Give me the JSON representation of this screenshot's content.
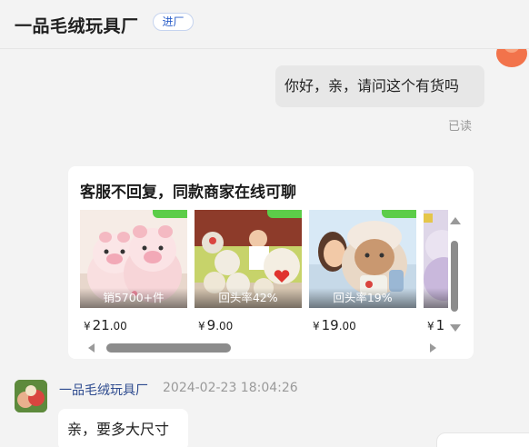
{
  "header": {
    "shop_name": "一品毛绒玩具厂",
    "enter_label": "进厂"
  },
  "messages": {
    "outgoing_text": "你好，亲，请问这个有货吗",
    "read_status": "已读",
    "incoming_sender": "一品毛绒玩具厂",
    "incoming_time": "2024-02-23 18:04:26",
    "incoming_text": "亲，要多大尺寸"
  },
  "card": {
    "title": "客服不回复，同款商家在线可聊",
    "products": [
      {
        "overlay": "销5700+件",
        "currency": "¥",
        "price_int": "21",
        "price_dec": ".00"
      },
      {
        "overlay": "回头率42%",
        "currency": "¥",
        "price_int": "9",
        "price_dec": ".00"
      },
      {
        "overlay": "回头率19%",
        "currency": "¥",
        "price_int": "19",
        "price_dec": ".00"
      },
      {
        "overlay": "",
        "currency": "¥",
        "price_int": "1",
        "price_dec": ""
      }
    ]
  },
  "colors": {
    "accent_blue": "#2b5fc9",
    "tag_green": "#5ccd49",
    "avatar_orange": "#f2734b"
  },
  "icons": {
    "scroll_up": "triangle-up-icon",
    "scroll_down": "triangle-down-icon",
    "scroll_left": "triangle-left-icon",
    "scroll_right": "triangle-right-icon"
  }
}
